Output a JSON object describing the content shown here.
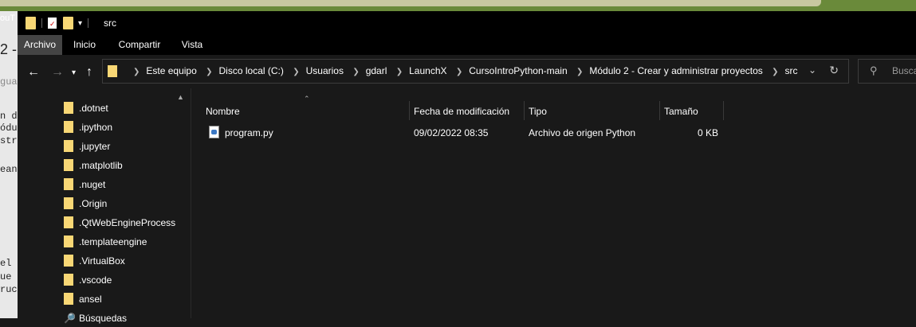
{
  "window": {
    "title": "src",
    "ribbon_tabs": [
      "Archivo",
      "Inicio",
      "Compartir",
      "Vista"
    ]
  },
  "address_bar": {
    "crumbs": [
      "Este equipo",
      "Disco local (C:)",
      "Usuarios",
      "gdarl",
      "LaunchX",
      "CursoIntroPython-main",
      "Módulo 2 - Crear y administrar proyectos",
      "src"
    ]
  },
  "search": {
    "placeholder": "Busca"
  },
  "nav": {
    "items": [
      ".dotnet",
      ".ipython",
      ".jupyter",
      ".matplotlib",
      ".nuget",
      ".Origin",
      ".QtWebEngineProcess",
      ".templateengine",
      ".VirtualBox",
      ".vscode",
      "ansel",
      "Búsquedas"
    ]
  },
  "columns": [
    "Nombre",
    "Fecha de modificación",
    "Tipo",
    "Tamaño"
  ],
  "files": [
    {
      "name": "program.py",
      "modified": "09/02/2022 08:35",
      "type": "Archivo de origen Python",
      "size": "0 KB"
    }
  ],
  "background": {
    "top_left_text": "ouT",
    "left_strip": [
      "2 -",
      "guai",
      "n de",
      "ódul",
      "stro",
      "ean",
      "el c",
      "ue l",
      "ruct"
    ]
  }
}
